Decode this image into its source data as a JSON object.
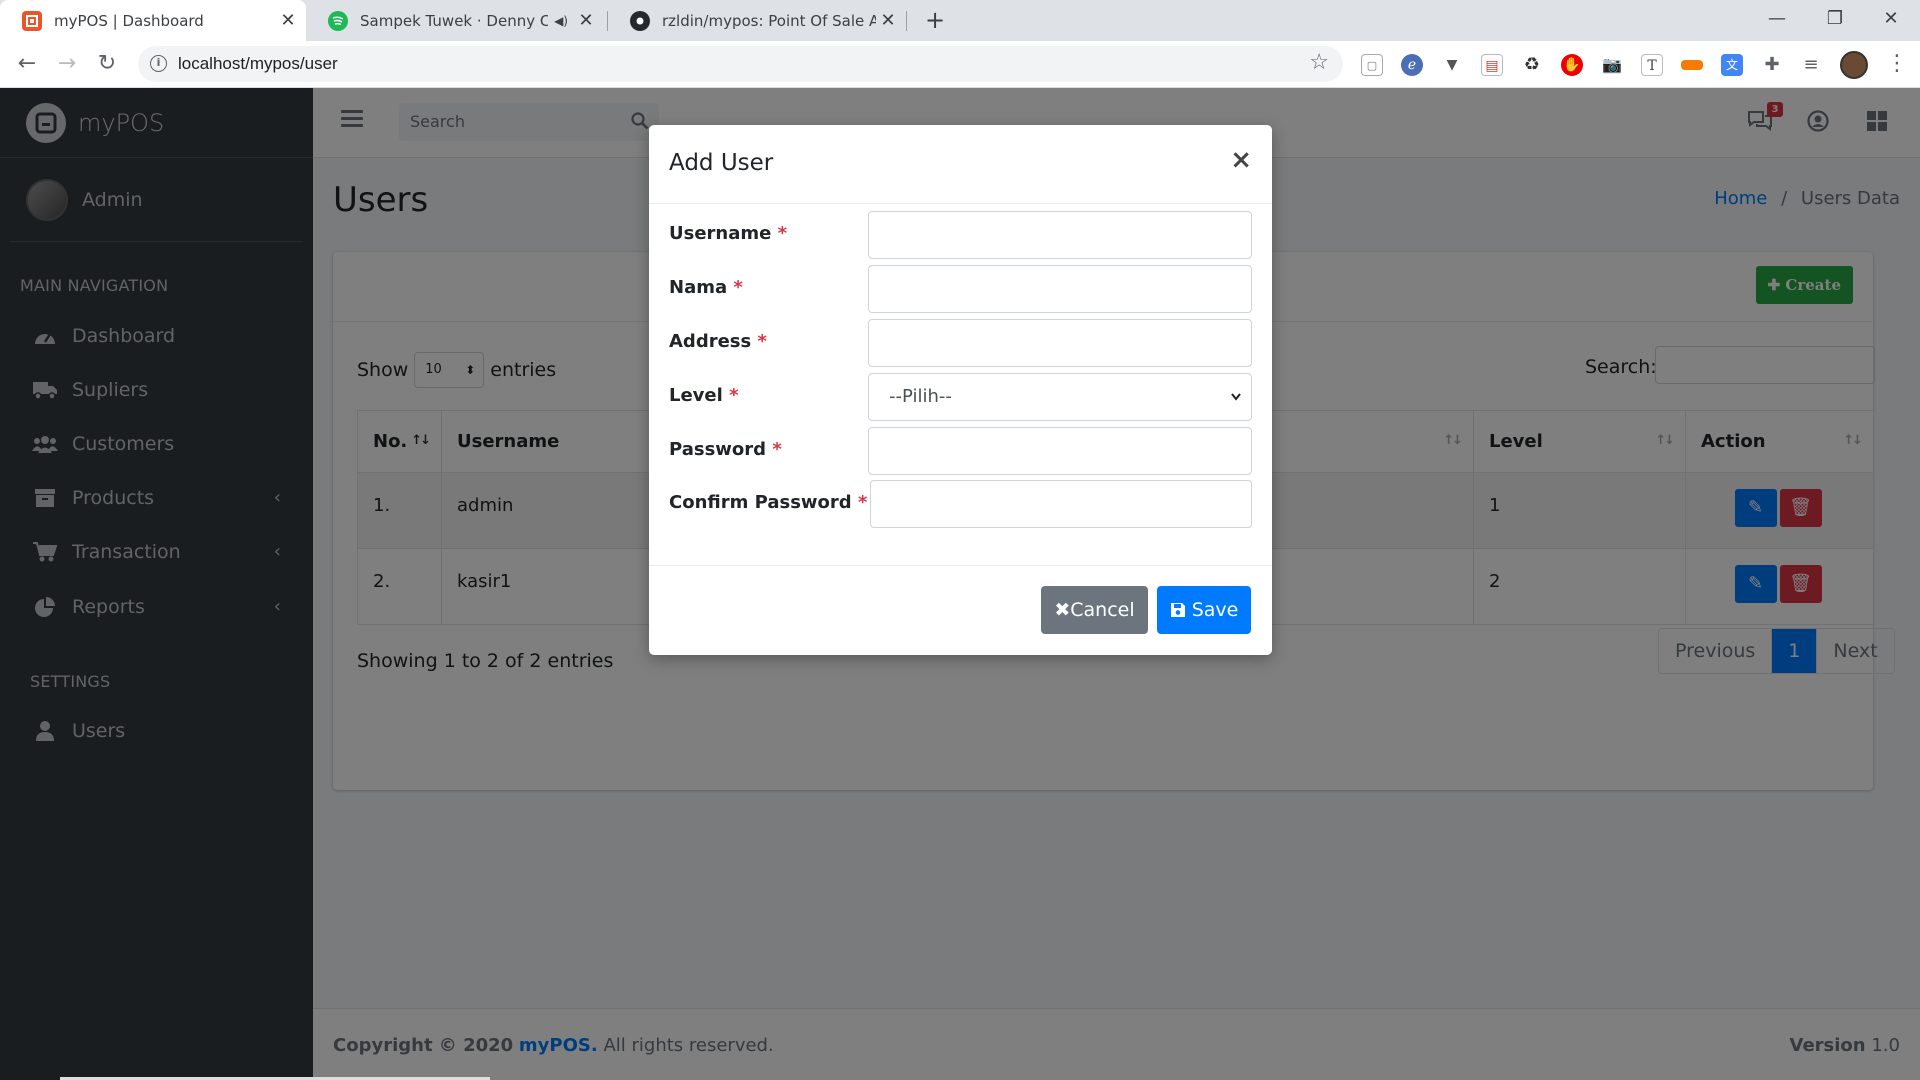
{
  "browser": {
    "tabs": [
      {
        "title": "myPOS | Dashboard",
        "active": true,
        "favicon": "mypos-favicon"
      },
      {
        "title": "Sampek Tuwek · Denny Cakn",
        "active": false,
        "favicon": "spotify-favicon"
      },
      {
        "title": "rzldin/mypos: Point Of Sale Appli",
        "active": false,
        "favicon": "github-favicon"
      }
    ],
    "url": "localhost/mypos/user"
  },
  "sidebar": {
    "brand": "myPOS",
    "user": "Admin",
    "main_header": "MAIN NAVIGATION",
    "items": [
      {
        "label": "Dashboard",
        "icon": "dashboard-icon"
      },
      {
        "label": "Supliers",
        "icon": "truck-icon"
      },
      {
        "label": "Customers",
        "icon": "users-icon"
      },
      {
        "label": "Products",
        "icon": "archive-icon"
      },
      {
        "label": "Transaction",
        "icon": "cart-icon"
      },
      {
        "label": "Reports",
        "icon": "chart-pie-icon"
      }
    ],
    "settings_header": "SETTINGS",
    "settings_items": [
      {
        "label": "Users",
        "icon": "user-icon"
      }
    ]
  },
  "header": {
    "search_placeholder": "Search",
    "notification_count": "3"
  },
  "page": {
    "title": "Users",
    "breadcrumb": {
      "home": "Home",
      "current": "Users Data"
    },
    "create_button": "Create",
    "show_label": "Show",
    "entries_value": "10",
    "entries_label": "entries",
    "search_label": "Search:",
    "table": {
      "columns": [
        "No.",
        "Username",
        "Level",
        "Action"
      ],
      "rows": [
        {
          "no": "1.",
          "username": "admin",
          "level": "1"
        },
        {
          "no": "2.",
          "username": "kasir1",
          "level": "2"
        }
      ]
    },
    "showing": "Showing 1 to 2 of 2 entries",
    "pagination": {
      "previous": "Previous",
      "current": "1",
      "next": "Next"
    }
  },
  "footer": {
    "copyright": "Copyright © 2020",
    "brand": "myPOS.",
    "rights": "All rights reserved.",
    "version_label": "Version",
    "version": "1.0"
  },
  "modal": {
    "title": "Add User",
    "close": "×",
    "fields": [
      {
        "label": "Username",
        "required": "*"
      },
      {
        "label": "Nama",
        "required": "*"
      },
      {
        "label": "Address",
        "required": "*"
      },
      {
        "label": "Level",
        "required": "*",
        "value": "--Pilih--"
      },
      {
        "label": "Password",
        "required": "*"
      },
      {
        "label": "Confirm Password",
        "required": "*"
      }
    ],
    "cancel": "Cancel",
    "save": "Save"
  }
}
